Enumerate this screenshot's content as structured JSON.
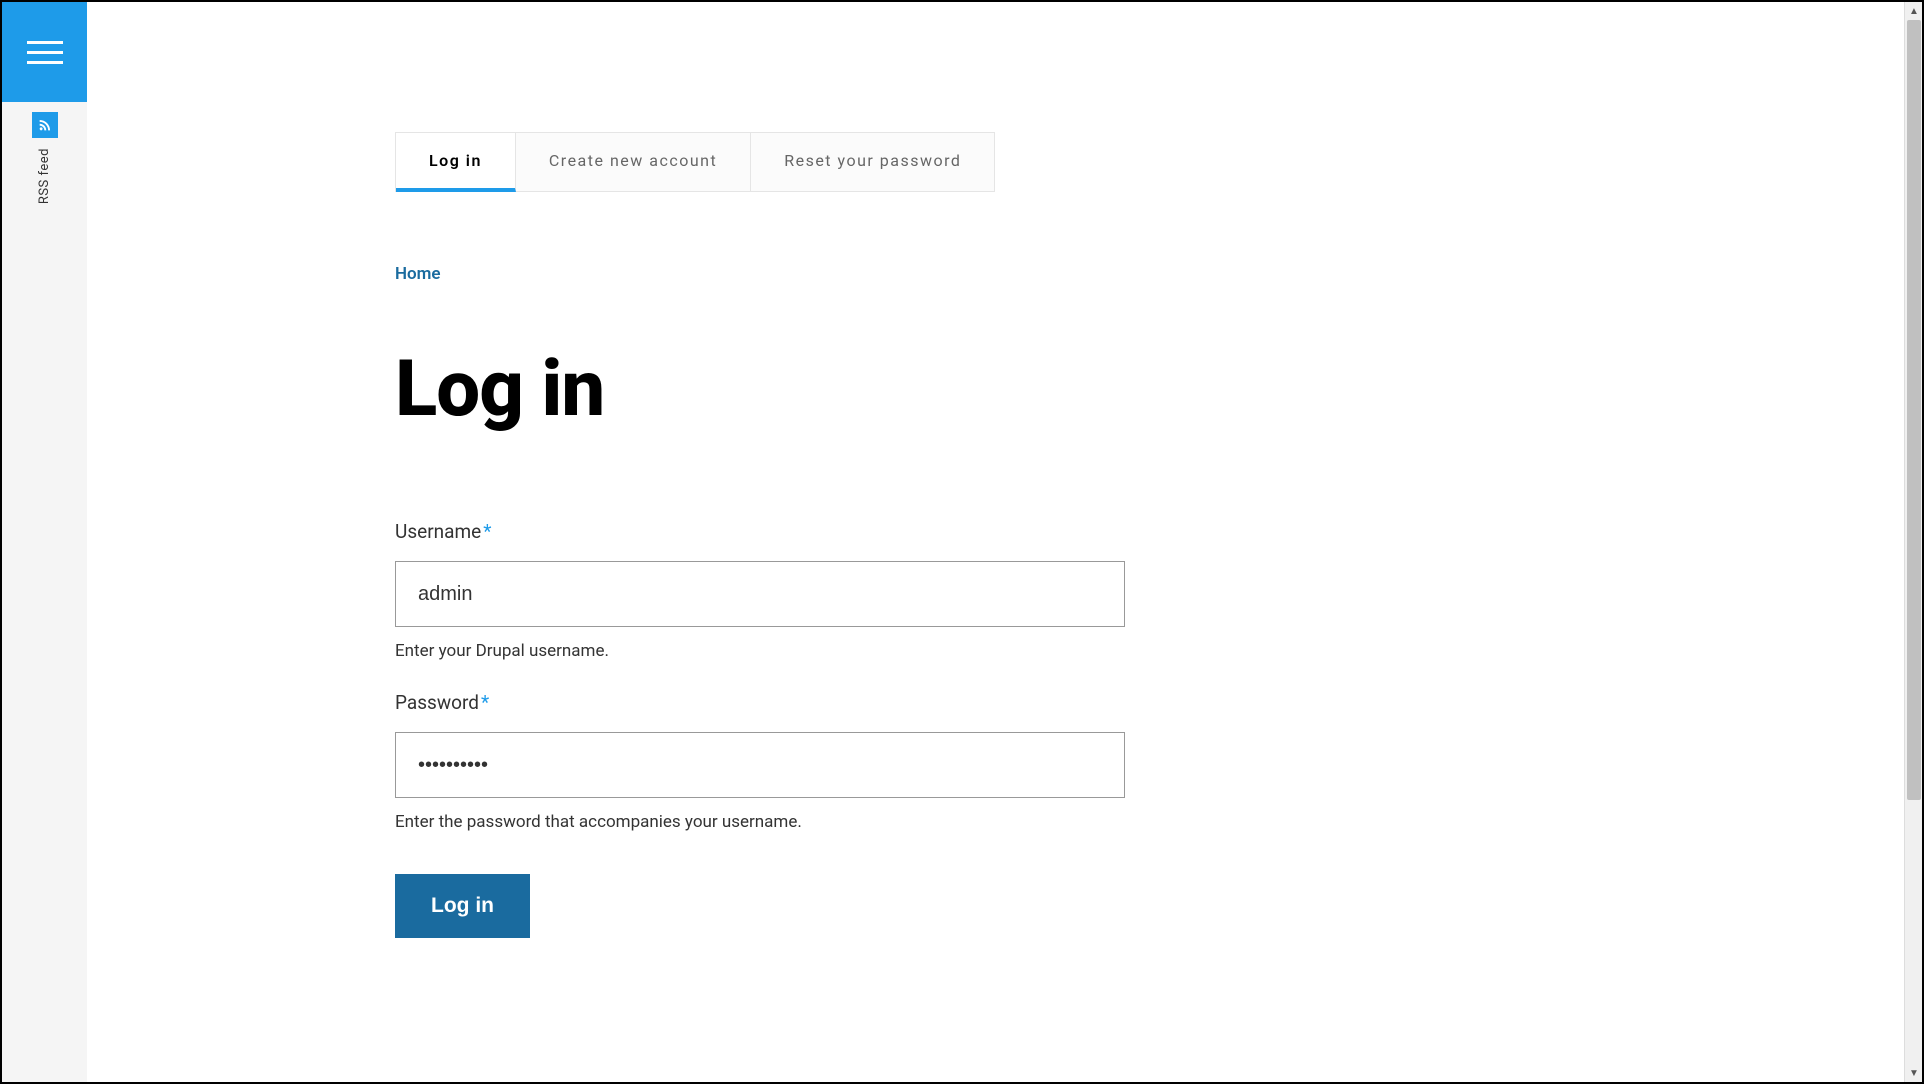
{
  "sidebar": {
    "rss_label": "RSS feed"
  },
  "tabs": [
    {
      "label": "Log in",
      "active": true
    },
    {
      "label": "Create new account",
      "active": false
    },
    {
      "label": "Reset your password",
      "active": false
    }
  ],
  "breadcrumb": {
    "home": "Home"
  },
  "page": {
    "title": "Log in"
  },
  "form": {
    "username": {
      "label": "Username",
      "value": "admin",
      "help": "Enter your Drupal username."
    },
    "password": {
      "label": "Password",
      "value": "••••••••••",
      "help": "Enter the password that accompanies your username."
    },
    "submit_label": "Log in"
  }
}
